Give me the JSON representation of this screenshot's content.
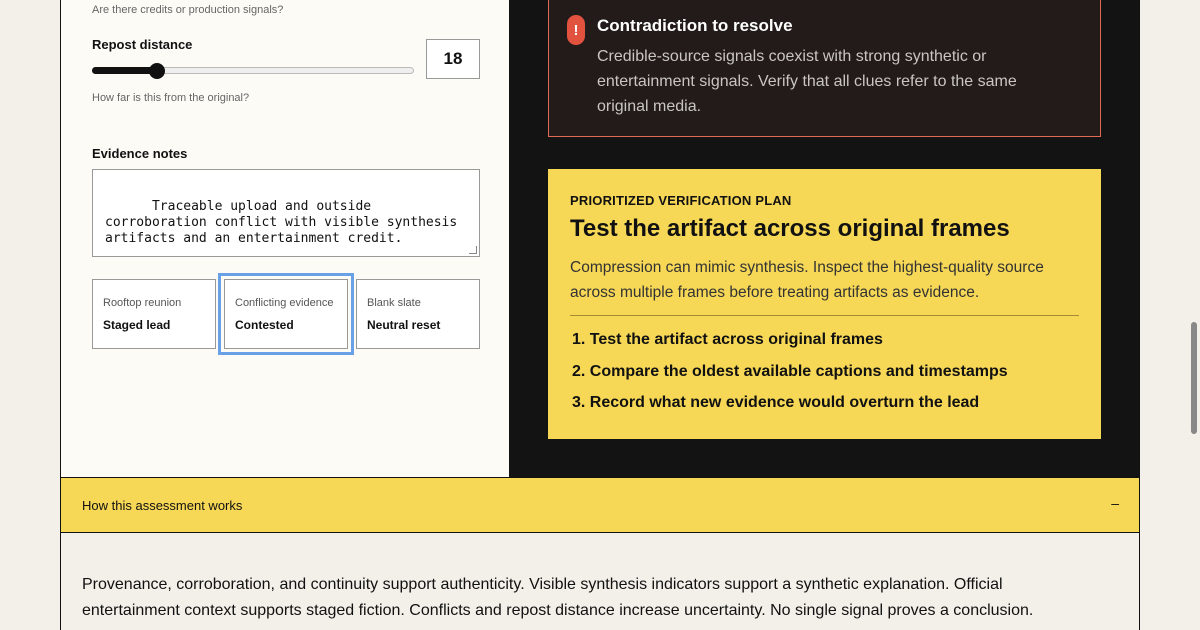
{
  "form": {
    "credits_hint": "Are there credits or production signals?",
    "repost_label": "Repost distance",
    "repost_value": "18",
    "repost_fraction": 0.2,
    "repost_hint": "How far is this from the original?",
    "notes_label": "Evidence notes",
    "notes_value": "Traceable upload and outside corroboration conflict with visible synthesis artifacts and an entertainment credit.",
    "presets": [
      {
        "kicker": "Rooftop reunion",
        "value": "Staged lead"
      },
      {
        "kicker": "Conflicting evidence",
        "value": "Contested"
      },
      {
        "kicker": "Blank slate",
        "value": "Neutral reset"
      }
    ]
  },
  "alert": {
    "icon": "exclamation-icon",
    "title": "Contradiction to resolve",
    "body": "Credible-source signals coexist with strong synthetic or entertainment signals. Verify that all clues refer to the same original media."
  },
  "plan": {
    "eyebrow": "PRIORITIZED VERIFICATION PLAN",
    "title": "Test the artifact across original frames",
    "body": "Compression can mimic synthesis. Inspect the highest-quality source across multiple frames before treating artifacts as evidence.",
    "steps": [
      "1. Test the artifact across original frames",
      "2. Compare the oldest available captions and timestamps",
      "3. Record what new evidence would overturn the lead"
    ]
  },
  "accordion": {
    "title": "How this assessment works",
    "toggle": "–",
    "body": "Provenance, corroboration, and continuity support authenticity. Visible synthesis indicators support a synthetic explanation. Official entertainment context supports staged fiction. Conflicts and repost distance increase uncertainty. No single signal proves a conclusion."
  },
  "colors": {
    "accent_yellow": "#f6d756",
    "alert_red": "#e2533f",
    "selection_blue": "#6aa0e6",
    "dark_panel": "#131313"
  }
}
